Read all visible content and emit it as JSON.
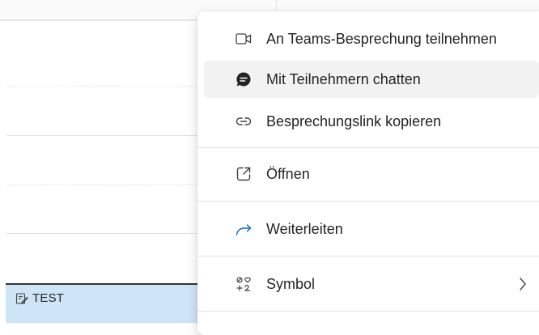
{
  "calendar": {
    "event_title": "TEST"
  },
  "menu": {
    "items": [
      {
        "label": "An Teams-Besprechung teilnehmen",
        "icon": "video-camera-icon"
      },
      {
        "label": "Mit Teilnehmern chatten",
        "icon": "chat-bubble-icon"
      },
      {
        "label": "Besprechungslink kopieren",
        "icon": "link-icon"
      },
      {
        "label": "Öffnen",
        "icon": "open-external-icon"
      },
      {
        "label": "Weiterleiten",
        "icon": "forward-arrow-icon"
      },
      {
        "label": "Symbol",
        "icon": "symbol-icon"
      }
    ]
  },
  "colors": {
    "accent": "#0f6cbd",
    "event_bg": "#cfe4f7",
    "hover_bg": "#f2f2f2",
    "text": "#242424"
  }
}
